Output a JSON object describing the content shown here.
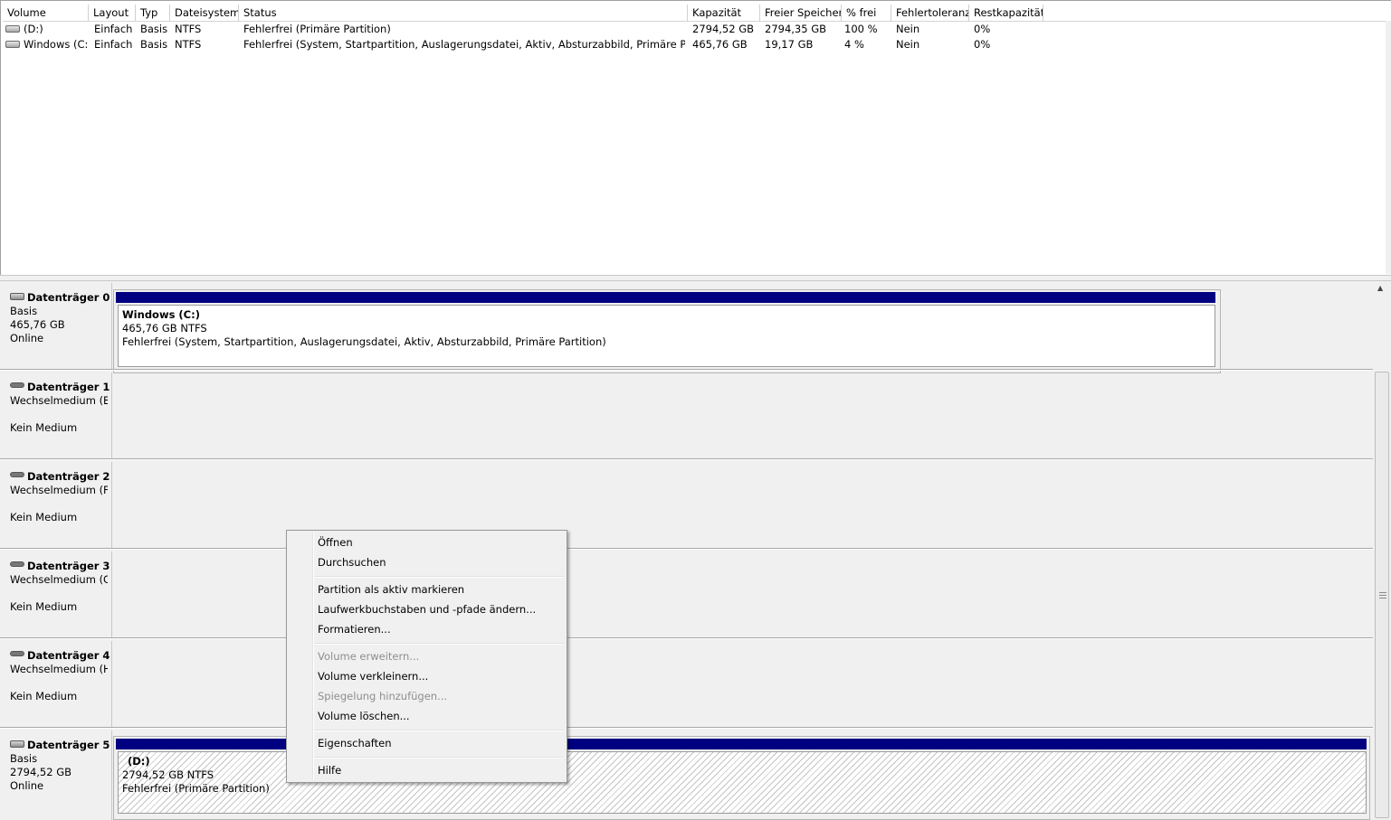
{
  "volume_list": {
    "columns": [
      "Volume",
      "Layout",
      "Typ",
      "Dateisystem",
      "Status",
      "Kapazität",
      "Freier Speicher",
      "% frei",
      "Fehlertoleranz",
      "Restkapazität"
    ],
    "rows": [
      {
        "volume": "(D:)",
        "layout": "Einfach",
        "typ": "Basis",
        "dateisystem": "NTFS",
        "status": "Fehlerfrei (Primäre Partition)",
        "kapazitaet": "2794,52 GB",
        "frei": "2794,35 GB",
        "prozent": "100 %",
        "fehlertoleranz": "Nein",
        "rest": "0%"
      },
      {
        "volume": "Windows (C:)",
        "layout": "Einfach",
        "typ": "Basis",
        "dateisystem": "NTFS",
        "status": "Fehlerfrei (System, Startpartition, Auslagerungsdatei, Aktiv, Absturzabbild, Primäre Partition)",
        "kapazitaet": "465,76 GB",
        "frei": "19,17 GB",
        "prozent": "4 %",
        "fehlertoleranz": "Nein",
        "rest": "0%"
      }
    ]
  },
  "disks": [
    {
      "name": "Datenträger 0",
      "line1": "Basis",
      "line2": "465,76 GB",
      "line3": "Online",
      "partition": {
        "name": "Windows  (C:)",
        "size": "465,76 GB NTFS",
        "status": "Fehlerfrei (System, Startpartition, Auslagerungsdatei, Aktiv, Absturzabbild, Primäre Partition)"
      }
    },
    {
      "name": "Datenträger 1",
      "line1": "Wechselmedium (E:",
      "line2": "",
      "line3": "Kein Medium"
    },
    {
      "name": "Datenträger 2",
      "line1": "Wechselmedium (F:",
      "line2": "",
      "line3": "Kein Medium"
    },
    {
      "name": "Datenträger 3",
      "line1": "Wechselmedium (G:",
      "line2": "",
      "line3": "Kein Medium"
    },
    {
      "name": "Datenträger 4",
      "line1": "Wechselmedium (H",
      "line2": "",
      "line3": "Kein Medium"
    },
    {
      "name": "Datenträger 5",
      "line1": "Basis",
      "line2": "2794,52 GB",
      "line3": "Online",
      "partition": {
        "name": "(D:)",
        "size": "2794,52 GB NTFS",
        "status": "Fehlerfrei (Primäre Partition)"
      }
    }
  ],
  "context_menu": {
    "items": [
      {
        "label": "Öffnen",
        "enabled": true
      },
      {
        "label": "Durchsuchen",
        "enabled": true
      },
      {
        "label": "Partition als aktiv markieren",
        "enabled": true
      },
      {
        "label": "Laufwerkbuchstaben und -pfade ändern...",
        "enabled": true
      },
      {
        "label": "Formatieren...",
        "enabled": true
      },
      {
        "label": "Volume erweitern...",
        "enabled": false
      },
      {
        "label": "Volume verkleinern...",
        "enabled": true
      },
      {
        "label": "Spiegelung hinzufügen...",
        "enabled": false
      },
      {
        "label": "Volume löschen...",
        "enabled": true
      },
      {
        "label": "Eigenschaften",
        "enabled": true
      },
      {
        "label": "Hilfe",
        "enabled": true
      }
    ]
  },
  "colors": {
    "partition_bar": "#000080",
    "background": "#f0f0f0"
  }
}
